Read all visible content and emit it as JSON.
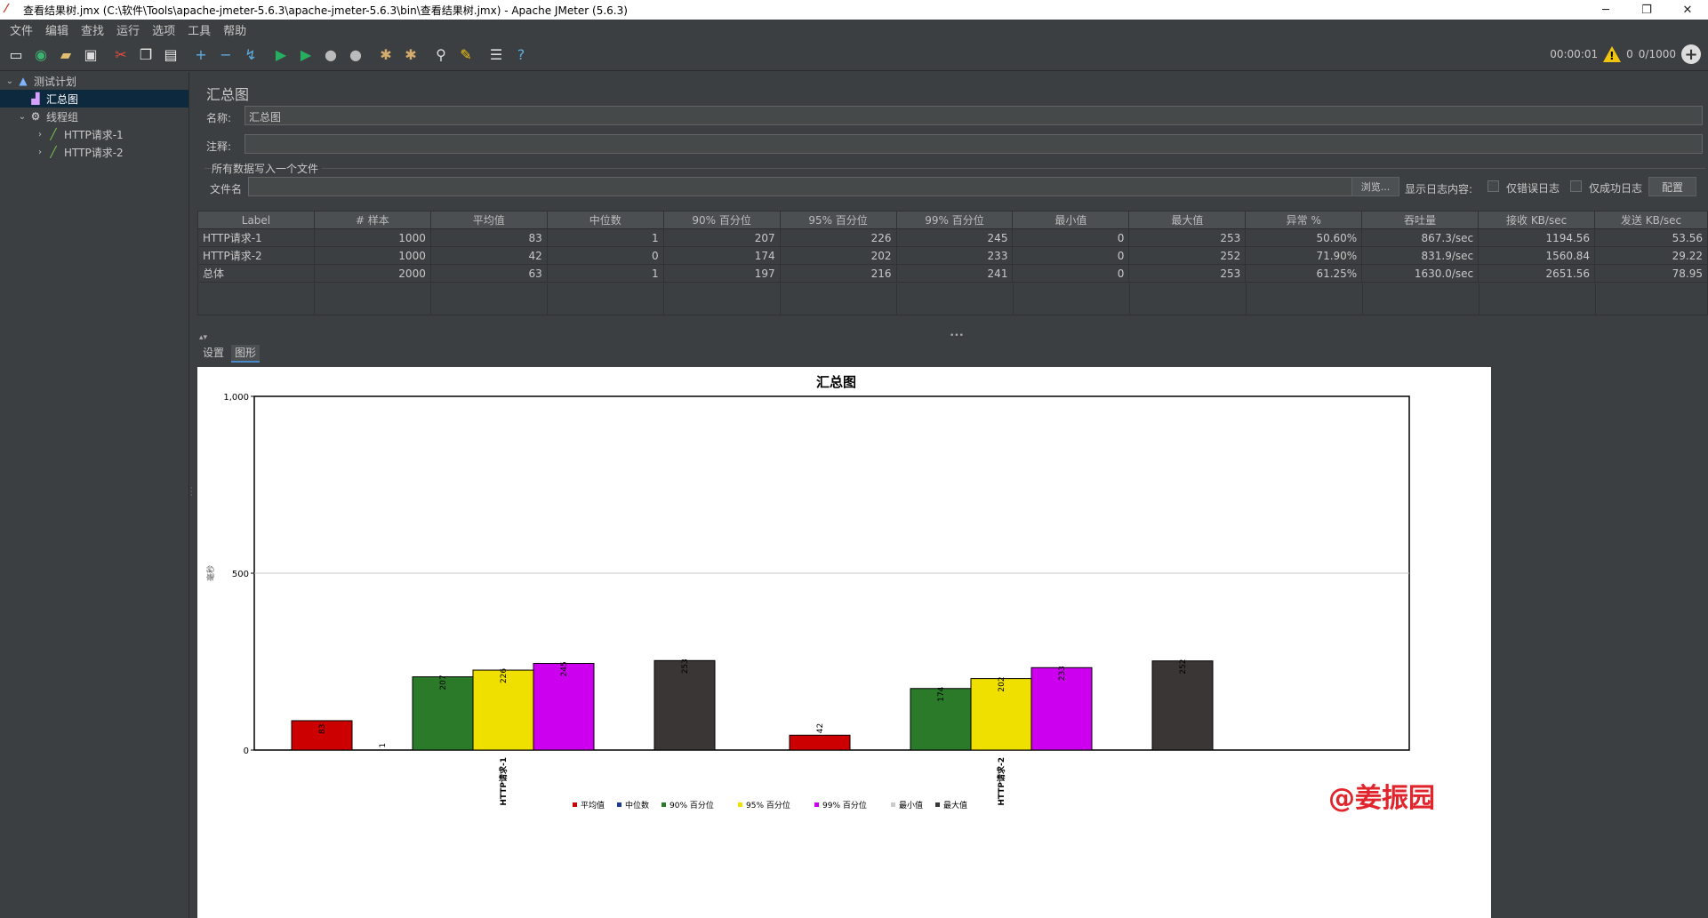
{
  "window": {
    "title": "查看结果树.jmx (C:\\软件\\Tools\\apache-jmeter-5.6.3\\apache-jmeter-5.6.3\\bin\\查看结果树.jmx) - Apache JMeter (5.6.3)",
    "minimize": "─",
    "maximize": "❐",
    "close": "✕"
  },
  "menu": [
    "文件",
    "编辑",
    "查找",
    "运行",
    "选项",
    "工具",
    "帮助"
  ],
  "toolbar": {
    "timer": "00:00:01",
    "warnings": "0",
    "threads": "0/1000",
    "icons": [
      "new-icon",
      "templates-icon",
      "open-icon",
      "save-icon",
      "cut-icon",
      "copy-icon",
      "paste-icon",
      "expand-icon",
      "collapse-icon",
      "toggle-icon",
      "start-icon",
      "start-no-pause-icon",
      "stop-icon",
      "shutdown-icon",
      "clear-icon",
      "clear-all-icon",
      "search-icon",
      "reset-search-icon",
      "function-helper-icon",
      "help-icon"
    ]
  },
  "tree": [
    {
      "label": "测试计划",
      "level": 0,
      "icon": "test-plan-icon",
      "expanded": true,
      "selected": false
    },
    {
      "label": "汇总图",
      "level": 1,
      "icon": "aggregate-graph-icon",
      "expanded": null,
      "selected": true
    },
    {
      "label": "线程组",
      "level": 1,
      "icon": "thread-group-icon",
      "expanded": true,
      "selected": false
    },
    {
      "label": "HTTP请求-1",
      "level": 2,
      "icon": "http-sampler-icon",
      "expanded": false,
      "selected": false
    },
    {
      "label": "HTTP请求-2",
      "level": 2,
      "icon": "http-sampler-icon",
      "expanded": false,
      "selected": false
    }
  ],
  "panel": {
    "title": "汇总图",
    "name_label": "名称:",
    "name_value": "汇总图",
    "comment_label": "注释:",
    "comment_value": "",
    "section_title": "所有数据写入一个文件",
    "filename_label": "文件名",
    "filename_value": "",
    "browse_button": "浏览...",
    "log_content_label": "显示日志内容:",
    "errors_only_label": "仅错误日志",
    "success_only_label": "仅成功日志",
    "configure_button": "配置"
  },
  "table": {
    "headers": [
      "Label",
      "# 样本",
      "平均值",
      "中位数",
      "90% 百分位",
      "95% 百分位",
      "99% 百分位",
      "最小值",
      "最大值",
      "异常 %",
      "吞吐量",
      "接收 KB/sec",
      "发送 KB/sec"
    ],
    "rows": [
      [
        "HTTP请求-1",
        "1000",
        "83",
        "1",
        "207",
        "226",
        "245",
        "0",
        "253",
        "50.60%",
        "867.3/sec",
        "1194.56",
        "53.56"
      ],
      [
        "HTTP请求-2",
        "1000",
        "42",
        "0",
        "174",
        "202",
        "233",
        "0",
        "252",
        "71.90%",
        "831.9/sec",
        "1560.84",
        "29.22"
      ],
      [
        "总体",
        "2000",
        "63",
        "1",
        "197",
        "216",
        "241",
        "0",
        "253",
        "61.25%",
        "1630.0/sec",
        "2651.56",
        "78.95"
      ]
    ]
  },
  "tabs": [
    "设置",
    "图形"
  ],
  "active_tab": "图形",
  "chart_data": {
    "type": "bar",
    "title": "汇总图",
    "ylabel": "毫秒",
    "xlabel": "",
    "ylim": [
      0,
      1000
    ],
    "yticks": [
      "0",
      "500",
      "1,000"
    ],
    "grid": true,
    "legend_position": "bottom",
    "categories": [
      "HTTP请求-1",
      "HTTP请求-2"
    ],
    "series": [
      {
        "name": "平均值",
        "color": "#cc0000",
        "values": [
          83,
          42
        ]
      },
      {
        "name": "中位数",
        "color": "#1f3a93",
        "values": [
          1,
          0
        ]
      },
      {
        "name": "90% 百分位",
        "color": "#2a7a2a",
        "values": [
          207,
          174
        ]
      },
      {
        "name": "95% 百分位",
        "color": "#f0e000",
        "values": [
          226,
          202
        ]
      },
      {
        "name": "99% 百分位",
        "color": "#cc00ee",
        "values": [
          245,
          233
        ]
      },
      {
        "name": "最小值",
        "color": "#cccccc",
        "values": [
          0,
          0
        ]
      },
      {
        "name": "最大值",
        "color": "#3a3636",
        "values": [
          253,
          252
        ]
      }
    ],
    "bar_labels": [
      [
        "83",
        "1",
        "207",
        "226",
        "245",
        "",
        "253"
      ],
      [
        "42",
        "",
        "174",
        "202",
        "233",
        "",
        "252"
      ]
    ]
  },
  "watermark": "@姜振园"
}
